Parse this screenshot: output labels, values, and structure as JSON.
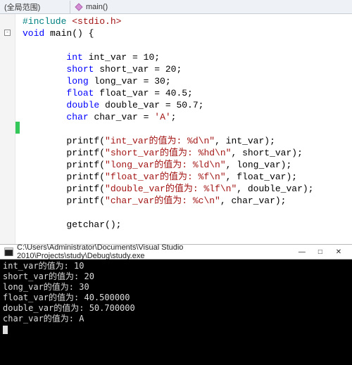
{
  "top": {
    "scope": "(全局范围)",
    "func_icon": "diamond",
    "func": "main()"
  },
  "code": {
    "lines": [
      {
        "i": 0,
        "indent": 0,
        "segs": [
          {
            "c": "k-teal",
            "t": "#include "
          },
          {
            "c": "k-red",
            "t": "<stdio.h>"
          }
        ]
      },
      {
        "i": 1,
        "indent": 0,
        "fold": true,
        "segs": [
          {
            "c": "k-blue",
            "t": "void"
          },
          {
            "c": "plain",
            "t": " main() {"
          }
        ]
      },
      {
        "i": 2,
        "indent": 0,
        "segs": []
      },
      {
        "i": 3,
        "indent": 2,
        "segs": [
          {
            "c": "k-blue",
            "t": "int"
          },
          {
            "c": "plain",
            "t": " int_var = 10;"
          }
        ]
      },
      {
        "i": 4,
        "indent": 2,
        "segs": [
          {
            "c": "k-blue",
            "t": "short"
          },
          {
            "c": "plain",
            "t": " short_var = 20;"
          }
        ]
      },
      {
        "i": 5,
        "indent": 2,
        "segs": [
          {
            "c": "k-blue",
            "t": "long"
          },
          {
            "c": "plain",
            "t": " long_var = 30;"
          }
        ]
      },
      {
        "i": 6,
        "indent": 2,
        "segs": [
          {
            "c": "k-blue",
            "t": "float"
          },
          {
            "c": "plain",
            "t": " float_var = 40.5;"
          }
        ]
      },
      {
        "i": 7,
        "indent": 2,
        "segs": [
          {
            "c": "k-blue",
            "t": "double"
          },
          {
            "c": "plain",
            "t": " double_var = 50.7;"
          }
        ]
      },
      {
        "i": 8,
        "indent": 2,
        "segs": [
          {
            "c": "k-blue",
            "t": "char"
          },
          {
            "c": "plain",
            "t": " char_var = "
          },
          {
            "c": "k-red",
            "t": "'A'"
          },
          {
            "c": "plain",
            "t": ";"
          }
        ]
      },
      {
        "i": 9,
        "indent": 0,
        "change": true,
        "segs": []
      },
      {
        "i": 10,
        "indent": 2,
        "segs": [
          {
            "c": "plain",
            "t": "printf("
          },
          {
            "c": "k-red",
            "t": "\"int_var的值为: %d\\n\""
          },
          {
            "c": "plain",
            "t": ", int_var);"
          }
        ]
      },
      {
        "i": 11,
        "indent": 2,
        "segs": [
          {
            "c": "plain",
            "t": "printf("
          },
          {
            "c": "k-red",
            "t": "\"short_var的值为: %hd\\n\""
          },
          {
            "c": "plain",
            "t": ", short_var);"
          }
        ]
      },
      {
        "i": 12,
        "indent": 2,
        "segs": [
          {
            "c": "plain",
            "t": "printf("
          },
          {
            "c": "k-red",
            "t": "\"long_var的值为: %ld\\n\""
          },
          {
            "c": "plain",
            "t": ", long_var);"
          }
        ]
      },
      {
        "i": 13,
        "indent": 2,
        "segs": [
          {
            "c": "plain",
            "t": "printf("
          },
          {
            "c": "k-red",
            "t": "\"float_var的值为: %f\\n\""
          },
          {
            "c": "plain",
            "t": ", float_var);"
          }
        ]
      },
      {
        "i": 14,
        "indent": 2,
        "segs": [
          {
            "c": "plain",
            "t": "printf("
          },
          {
            "c": "k-red",
            "t": "\"double_var的值为: %lf\\n\""
          },
          {
            "c": "plain",
            "t": ", double_var);"
          }
        ]
      },
      {
        "i": 15,
        "indent": 2,
        "segs": [
          {
            "c": "plain",
            "t": "printf("
          },
          {
            "c": "k-red",
            "t": "\"char_var的值为: %c\\n\""
          },
          {
            "c": "plain",
            "t": ", char_var);"
          }
        ]
      },
      {
        "i": 16,
        "indent": 0,
        "segs": []
      },
      {
        "i": 17,
        "indent": 2,
        "segs": [
          {
            "c": "plain",
            "t": "getchar();"
          }
        ]
      },
      {
        "i": 18,
        "indent": 0,
        "segs": []
      },
      {
        "i": 19,
        "indent": 0,
        "segs": [
          {
            "c": "plain",
            "t": "}"
          }
        ]
      }
    ]
  },
  "console": {
    "title": "C:\\Users\\Administrator\\Documents\\Visual Studio 2010\\Projects\\study\\Debug\\study.exe",
    "lines": [
      "int_var的值为: 10",
      "short_var的值为: 20",
      "long_var的值为: 30",
      "float_var的值为: 40.500000",
      "double_var的值为: 50.700000",
      "char_var的值为: A"
    ]
  },
  "win_buttons": {
    "min": "—",
    "max": "□",
    "close": "✕"
  }
}
